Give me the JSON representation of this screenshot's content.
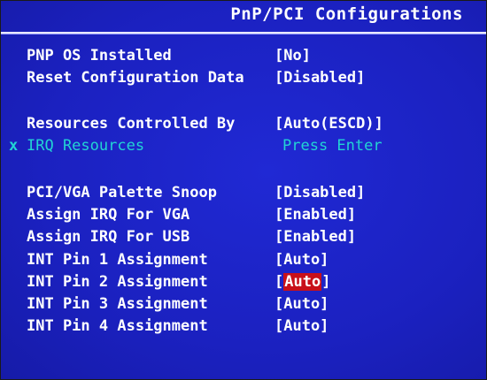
{
  "header": {
    "title": "PnP/PCI Configurations"
  },
  "colors": {
    "background": "#1c22c4",
    "text": "#ffffff",
    "inactive_text": "#22d4d4",
    "highlight": "#c8101a"
  },
  "settings": {
    "pnp_os": {
      "label": "PNP OS Installed",
      "value": "[No]"
    },
    "reset_config": {
      "label": "Reset Configuration Data",
      "value": "[Disabled]"
    },
    "resources_controlled": {
      "label": "Resources Controlled By",
      "value": "[Auto(ESCD)]"
    },
    "irq_resources": {
      "marker": "x",
      "label": "IRQ Resources",
      "value": "Press Enter"
    },
    "pci_vga_snoop": {
      "label": "PCI/VGA Palette Snoop",
      "value": "[Disabled]"
    },
    "irq_vga": {
      "label": "Assign IRQ For VGA",
      "value": "[Enabled]"
    },
    "irq_usb": {
      "label": "Assign IRQ For USB",
      "value": "[Enabled]"
    },
    "int_pin_1": {
      "label": "INT Pin 1 Assignment",
      "value": "[Auto]"
    },
    "int_pin_2": {
      "label": "INT Pin 2 Assignment",
      "value_open": "[",
      "value_selected": "Auto",
      "value_close": "]"
    },
    "int_pin_3": {
      "label": "INT Pin 3 Assignment",
      "value": "[Auto]"
    },
    "int_pin_4": {
      "label": "INT Pin 4 Assignment",
      "value": "[Auto]"
    }
  }
}
